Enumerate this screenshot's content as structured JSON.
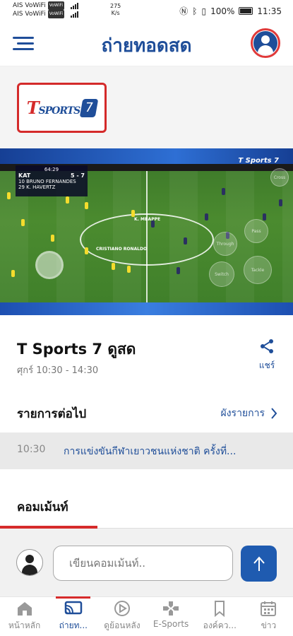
{
  "status_bar": {
    "carrier1": "AIS VoWiFi",
    "carrier2": "AIS VoWiFi",
    "volte_badge": "VoWiFi",
    "speed": "275",
    "speed_unit": "K/s",
    "battery": "100%",
    "time": "11:35"
  },
  "header": {
    "title": "ถ่ายทอดสด",
    "menu_icon": "hamburger-icon",
    "profile_icon": "user-icon"
  },
  "channel_logo": {
    "text_t": "T",
    "text_sports": "SPORTS",
    "text_seven": "7"
  },
  "video": {
    "scoreboard": {
      "clock": "64:29",
      "team": "KAT",
      "score": "5 - 7",
      "player1": "10 BRUNO FERNANDES",
      "player2": "29 K. HAVERTZ"
    },
    "label_mbappe": "K. MBAPPE",
    "label_ronaldo": "CRISTIANO RONALDO",
    "pad_buttons": [
      "Through",
      "Pass",
      "Tackle",
      "Switch",
      "Cross"
    ],
    "watermark": "T Sports 7"
  },
  "program": {
    "channel_name": "T Sports 7 ดูสด",
    "time": "ศุกร์ 10:30 - 14:30",
    "share_label": "แชร์"
  },
  "next": {
    "title": "รายการต่อไป",
    "schedule_link": "ผังรายการ",
    "item_time": "10:30",
    "item_title": "การแข่งขันกีฬาเยาวชนแห่งชาติ ครั้งที่..."
  },
  "comments": {
    "tab_label": "คอมเม้นท์",
    "placeholder": "เขียนคอมเม้นท์.."
  },
  "bottom_nav": {
    "items": [
      {
        "label": "หน้าหลัก",
        "icon": "home-icon"
      },
      {
        "label": "ถ่ายท...",
        "icon": "cast-icon"
      },
      {
        "label": "ดูย้อนหลัง",
        "icon": "play-icon"
      },
      {
        "label": "E-Sports",
        "icon": "gamepad-icon"
      },
      {
        "label": "องค์คว...",
        "icon": "bookmark-icon"
      },
      {
        "label": "ข่าว",
        "icon": "calendar-icon"
      }
    ]
  },
  "colors": {
    "brand_blue": "#1f4e99",
    "accent_red": "#d62b2b"
  }
}
